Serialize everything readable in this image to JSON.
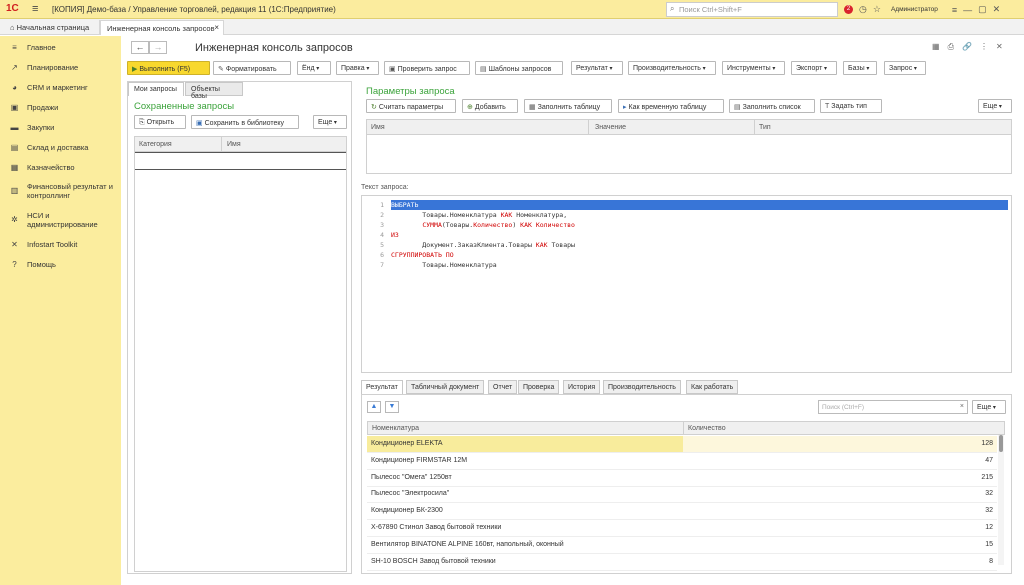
{
  "titlebar": {
    "logo": "1С",
    "title": "[КОПИЯ] Демо-база / Управление торговлей, редакция 11  (1С:Предприятие)",
    "search_placeholder": "Поиск Ctrl+Shift+F",
    "badge": "2",
    "user": "Администратор"
  },
  "tabs": {
    "home": "Начальная страница",
    "active": "Инженерная консоль запросов"
  },
  "sidebar": {
    "items": [
      {
        "label": "Главное",
        "icon": "hamburger-icon"
      },
      {
        "label": "Планирование",
        "icon": "chart-icon"
      },
      {
        "label": "CRM и маркетинг",
        "icon": "pie-icon"
      },
      {
        "label": "Продажи",
        "icon": "cart-icon"
      },
      {
        "label": "Закупки",
        "icon": "truck-icon"
      },
      {
        "label": "Склад и доставка",
        "icon": "box-icon"
      },
      {
        "label": "Казначейство",
        "icon": "money-icon"
      },
      {
        "label": "Финансовый результат и контроллинг",
        "icon": "bar-chart-icon"
      },
      {
        "label": "НСИ и администрирование",
        "icon": "gear-icon"
      },
      {
        "label": "Infostart Toolkit",
        "icon": "tools-icon"
      },
      {
        "label": "Помощь",
        "icon": "help-icon"
      }
    ]
  },
  "page": {
    "title": "Инженерная консоль запросов"
  },
  "toolbar": {
    "run": "Выполнить (F5)",
    "format": "Форматировать",
    "find": "Ёнд",
    "edit": "Правка",
    "check": "Проверить запрос",
    "templates": "Шаблоны запросов",
    "result": "Результат",
    "performance": "Производительность",
    "tools": "Инструменты",
    "export": "Экспорт",
    "bases": "Базы",
    "query": "Запрос"
  },
  "left": {
    "tab_my": "Мои запросы",
    "tab_objects": "Объекты базы",
    "title": "Сохраненные запросы",
    "open": "Открыть",
    "save_lib": "Сохранить в библиотеку",
    "more": "Еще",
    "col_category": "Категория",
    "col_name": "Имя"
  },
  "params": {
    "title": "Параметры запроса",
    "count": "Считать параметры",
    "add": "Добавить",
    "fill_table": "Заполнить таблицу",
    "as_temp": "Как временную таблицу",
    "fill_list": "Заполнить список",
    "set_type": "Задать тип",
    "more": "Еще",
    "col_name": "Имя",
    "col_value": "Значение",
    "col_type": "Тип"
  },
  "query": {
    "label": "Текст запроса:",
    "lines": [
      {
        "n": "1",
        "parts": [
          {
            "t": "ВЫБРАТЬ",
            "k": "kw"
          }
        ]
      },
      {
        "n": "2",
        "parts": [
          {
            "t": "        Товары.Номенклатура ",
            "k": "ob"
          },
          {
            "t": "КАК",
            "k": "kw"
          },
          {
            "t": " Номенклатура,",
            "k": "ob"
          }
        ]
      },
      {
        "n": "3",
        "parts": [
          {
            "t": "        ",
            "k": "ob"
          },
          {
            "t": "СУММА",
            "k": "kw"
          },
          {
            "t": "(Товары.",
            "k": "ob"
          },
          {
            "t": "Количество",
            "k": "kw"
          },
          {
            "t": ") ",
            "k": "ob"
          },
          {
            "t": "КАК Количество",
            "k": "kw"
          }
        ]
      },
      {
        "n": "4",
        "parts": [
          {
            "t": "ИЗ",
            "k": "kw"
          }
        ]
      },
      {
        "n": "5",
        "parts": [
          {
            "t": "        Документ.ЗаказКлиента.Товары ",
            "k": "ob"
          },
          {
            "t": "КАК",
            "k": "kw"
          },
          {
            "t": " Товары",
            "k": "ob"
          }
        ]
      },
      {
        "n": "6",
        "parts": [
          {
            "t": "СГРУППИРОВАТЬ ПО",
            "k": "kw"
          }
        ]
      },
      {
        "n": "7",
        "parts": [
          {
            "t": "        Товары.Номенклатура",
            "k": "ob"
          }
        ]
      }
    ]
  },
  "result": {
    "tabs": [
      "Результат",
      "Табличный документ",
      "Отчет",
      "Проверка",
      "История",
      "Производительность",
      "Как работать"
    ],
    "search_placeholder": "Поиск (Ctrl+F)",
    "more": "Еще",
    "col_item": "Номенклатура",
    "col_qty": "Количество",
    "rows": [
      {
        "item": "Кондиционер ELEKTA",
        "qty": "128"
      },
      {
        "item": "Кондиционер FIRMSTAR 12М",
        "qty": "47"
      },
      {
        "item": "Пылесос \"Омега\" 1250вт",
        "qty": "215"
      },
      {
        "item": "Пылесос \"Электросила\"",
        "qty": "32"
      },
      {
        "item": "Кондиционер БК-2300",
        "qty": "32"
      },
      {
        "item": "Х-67890 Стинол Завод бытовой техники",
        "qty": "12"
      },
      {
        "item": "Вентилятор BINATONE ALPINE 160вт, напольный, оконный",
        "qty": "15"
      },
      {
        "item": "SH-10 BOSCH Завод бытовой техники",
        "qty": "8"
      }
    ]
  }
}
